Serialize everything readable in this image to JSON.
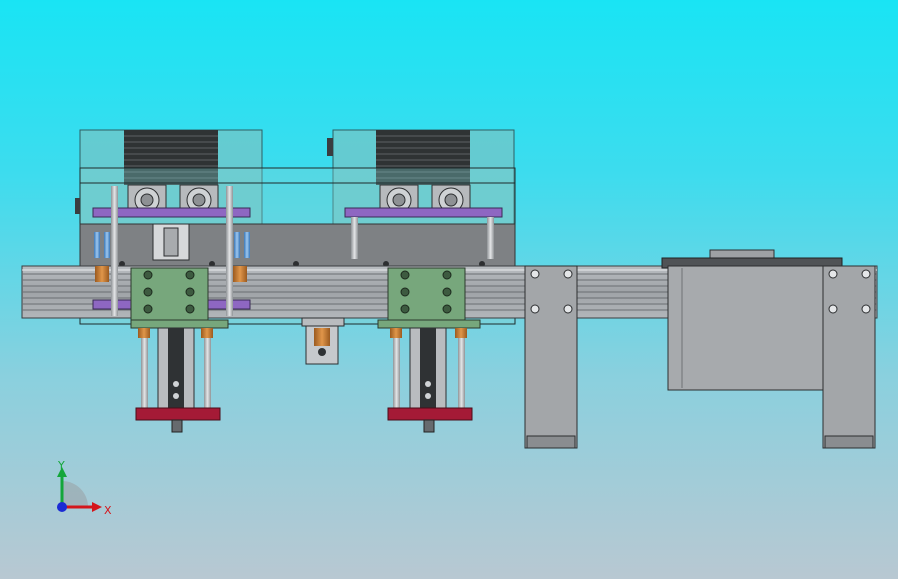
{
  "app": {
    "view": "front"
  },
  "colors": {
    "background_top": "#19e4f4",
    "background_bottom": "#b8c8d2",
    "glass": "#6cc9cc",
    "rail": "#a9adb1",
    "plate_gray": "#9a9c9f",
    "plate_purple": "#8e67c2",
    "plate_green": "#77a77c",
    "plate_red": "#a41a36",
    "bushing_orange": "#c9792b",
    "axis_x": "#d4151b",
    "axis_y": "#13a63a",
    "axis_z": "#1b2bd4"
  },
  "triad": {
    "x_label": "X",
    "y_label": "Y",
    "icons": [
      "x-axis-arrow-icon",
      "y-axis-arrow-icon",
      "z-axis-dot-icon"
    ]
  }
}
